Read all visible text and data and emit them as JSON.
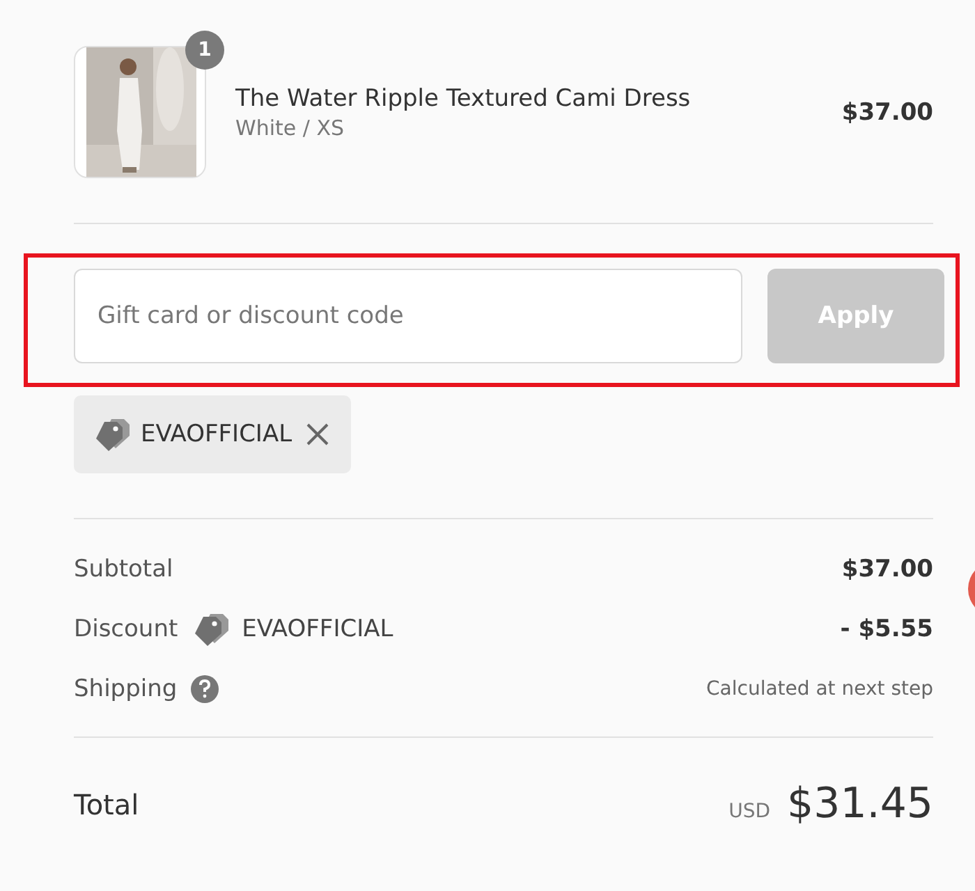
{
  "line_item": {
    "kind": "picture",
    "quantity": "1",
    "title": "The Water Ripple Textured Cami Dress",
    "variant": "White / XS",
    "price": "$37.00"
  },
  "discount_form": {
    "highlighted": true,
    "placeholder": "Gift card or discount code",
    "button": "Apply",
    "disabled": true
  },
  "applied_codes": [
    {
      "code": "EVAOFFICIAL"
    }
  ],
  "summary": [
    {
      "kind": "plain",
      "label": "Subtotal",
      "value": "$37.00"
    },
    {
      "kind": "discount",
      "label": "Discount",
      "code": "EVAOFFICIAL",
      "value": "- $5.55"
    },
    {
      "kind": "help",
      "label": "Shipping",
      "value": "Calculated at next step"
    }
  ],
  "total": {
    "label": "Total",
    "currency": "USD",
    "amount": "$31.45"
  }
}
